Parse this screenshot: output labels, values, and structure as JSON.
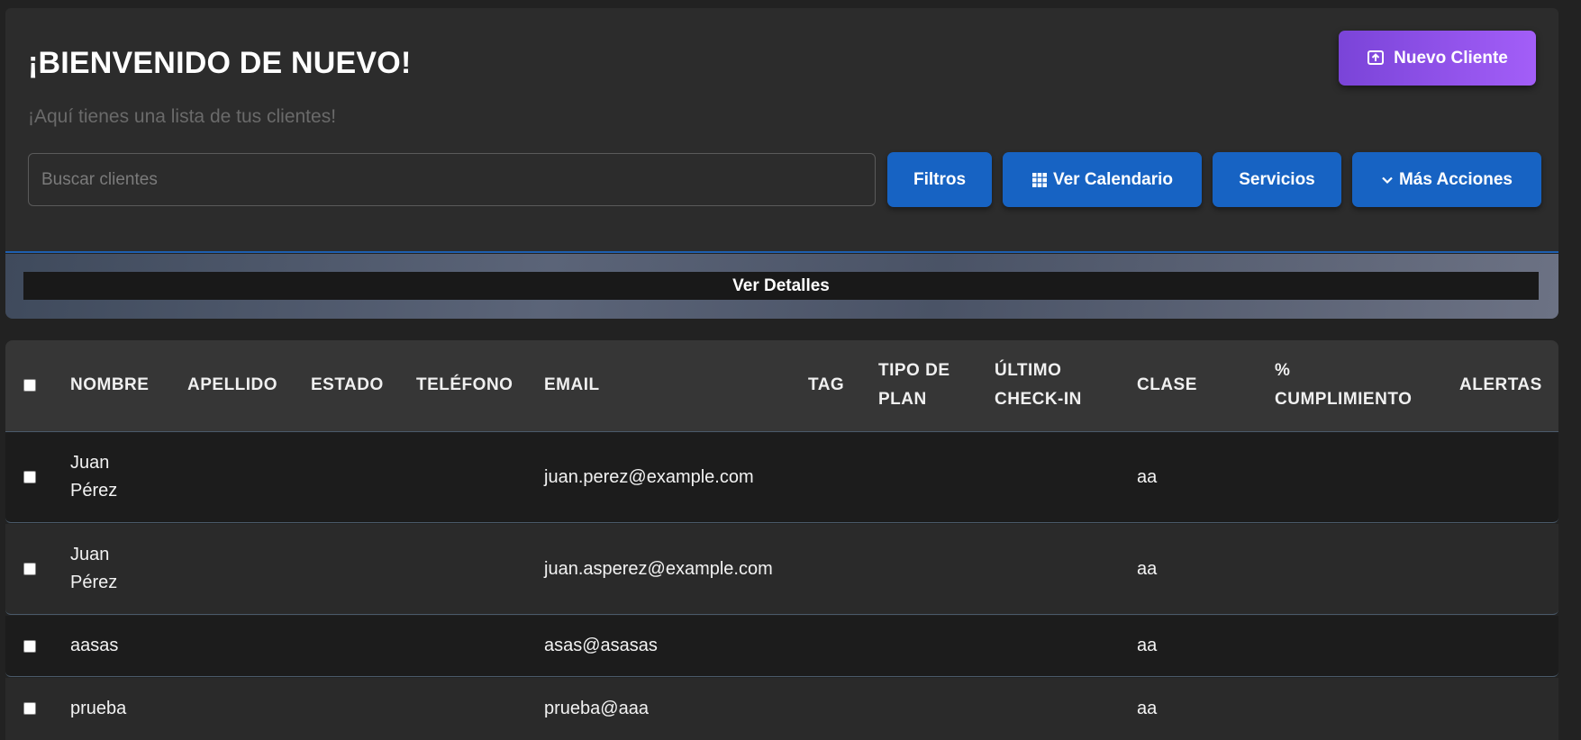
{
  "header": {
    "title": "¡BIENVENIDO DE NUEVO!",
    "subtitle": "¡Aquí tienes una lista de tus clientes!",
    "new_client_label": "Nuevo Cliente",
    "new_client_icon": "upload-box-icon",
    "search": {
      "placeholder": "Buscar clientes",
      "value": ""
    },
    "buttons": {
      "filtros": "Filtros",
      "calendario": "Ver Calendario",
      "calendario_icon": "grid-icon",
      "servicios": "Servicios",
      "mas_acciones": "Más Acciones",
      "mas_acciones_icon": "chevron-down-icon"
    }
  },
  "details": {
    "label": "Ver Detalles"
  },
  "table": {
    "columns": [
      {
        "key": "nombre",
        "lines": [
          "NOMBRE"
        ]
      },
      {
        "key": "apellido",
        "lines": [
          "APELLIDO"
        ]
      },
      {
        "key": "estado",
        "lines": [
          "ESTADO"
        ]
      },
      {
        "key": "telefono",
        "lines": [
          "TELÉFONO"
        ]
      },
      {
        "key": "email",
        "lines": [
          "EMAIL"
        ]
      },
      {
        "key": "tag",
        "lines": [
          "TAG"
        ]
      },
      {
        "key": "tipo_plan",
        "lines": [
          "TIPO DE",
          "PLAN"
        ]
      },
      {
        "key": "ultimo_checkin",
        "lines": [
          "ÚLTIMO",
          "CHECK-IN"
        ]
      },
      {
        "key": "clase",
        "lines": [
          "CLASE"
        ]
      },
      {
        "key": "cumplimiento",
        "lines": [
          "%",
          "CUMPLIMIENTO"
        ]
      },
      {
        "key": "alertas",
        "lines": [
          "ALERTAS"
        ]
      }
    ],
    "rows": [
      {
        "nombre": [
          "Juan",
          "Pérez"
        ],
        "email": "juan.perez@example.com",
        "clase": "aa",
        "checked": false
      },
      {
        "nombre": [
          "Juan",
          "Pérez"
        ],
        "email": "juan.asperez@example.com",
        "clase": "aa",
        "checked": false
      },
      {
        "nombre": [
          "aasas"
        ],
        "email": "asas@asasas",
        "clase": "aa",
        "checked": false
      },
      {
        "nombre": [
          "prueba"
        ],
        "email": "prueba@aaa",
        "clase": "aa",
        "checked": false
      }
    ]
  },
  "colors": {
    "accent_purple_start": "#7a44d8",
    "accent_purple_end": "#a35ef8",
    "button_blue": "#1763c3",
    "background": "#222222"
  }
}
